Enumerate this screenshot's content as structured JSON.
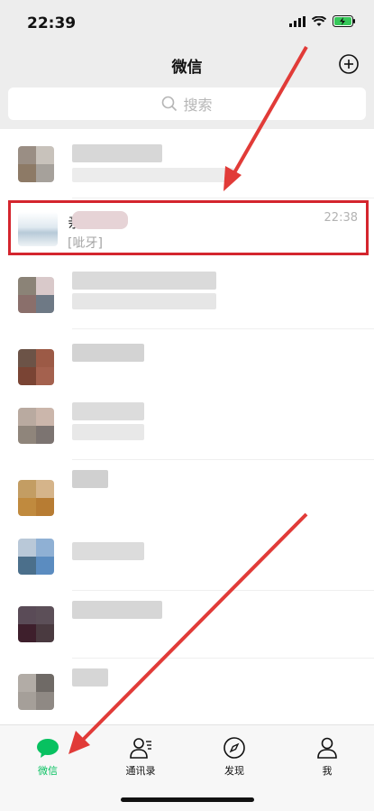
{
  "status": {
    "time": "22:39"
  },
  "header": {
    "title": "微信"
  },
  "search": {
    "placeholder": "搜索"
  },
  "chats": [
    {
      "time": "",
      "message": ""
    },
    {
      "name_visible": "亲",
      "time": "22:38",
      "message": "[呲牙]"
    },
    {
      "time": "",
      "message": ""
    },
    {
      "time": "",
      "message": ""
    },
    {
      "time": "",
      "message": ""
    },
    {
      "time": "",
      "message": ""
    },
    {
      "time": "",
      "message": ""
    },
    {
      "time": "",
      "message": ""
    },
    {
      "time": "",
      "message": ""
    }
  ],
  "tabs": [
    {
      "label": "微信",
      "icon": "chat-icon",
      "active": true
    },
    {
      "label": "通讯录",
      "icon": "contacts-icon"
    },
    {
      "label": "发现",
      "icon": "compass-icon"
    },
    {
      "label": "我",
      "icon": "person-icon"
    }
  ],
  "colors": {
    "accent": "#07c160",
    "annotation": "#d4252e"
  }
}
